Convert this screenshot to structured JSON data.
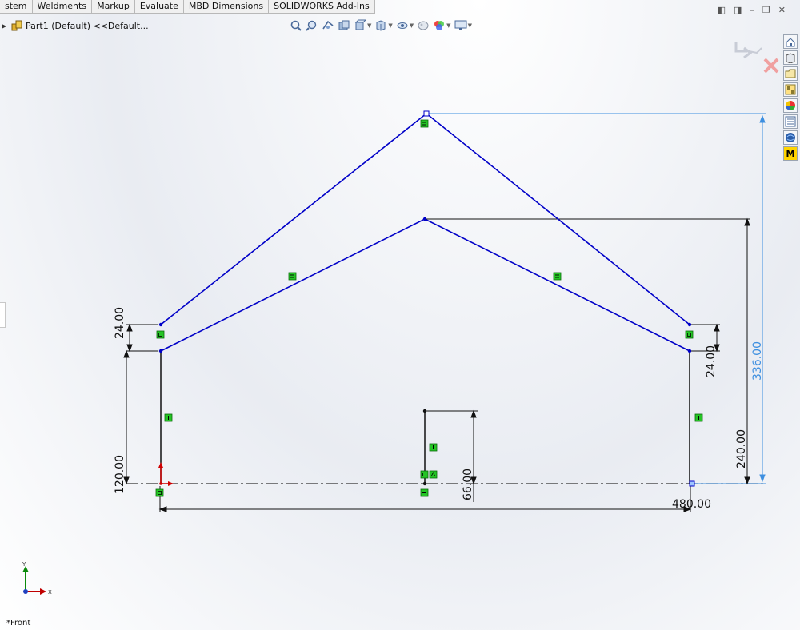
{
  "tabs": [
    "stem",
    "Weldments",
    "Markup",
    "Evaluate",
    "MBD Dimensions",
    "SOLIDWORKS Add-Ins"
  ],
  "tree": {
    "label": "Part1 (Default) <<Default..."
  },
  "heads_up": [
    "zoom-to-fit-icon",
    "zoom-to-area-icon",
    "previous-view-icon",
    "section-view-icon",
    "view-orientation-icon",
    "display-style-icon",
    "hide-show-icon",
    "edit-appearance-icon",
    "apply-scene-icon",
    "view-settings-icon"
  ],
  "task_pane": [
    "solidworks-resources-icon",
    "design-library-icon",
    "file-explorer-icon",
    "view-palette-icon",
    "appearances-icon",
    "custom-properties-icon",
    "solidworks-forum-icon",
    "m-icon"
  ],
  "task_pane_m_label": "M",
  "dimensions": {
    "roof_left_thickness": "24.00",
    "roof_right_thickness": "24.00",
    "wall_height": "120.00",
    "center_height": "66.00",
    "inner_peak_height": "240.00",
    "outer_peak_height": "336.00",
    "total_width": "480.00"
  },
  "triad": {
    "y": "Y",
    "x": "X"
  },
  "view_label": "*Front",
  "colors": {
    "sketch_line": "#0000c8",
    "dimension": "#111111",
    "driven_dimension": "#3d8fe0",
    "relation": "#25c425",
    "origin": "#d00000"
  }
}
